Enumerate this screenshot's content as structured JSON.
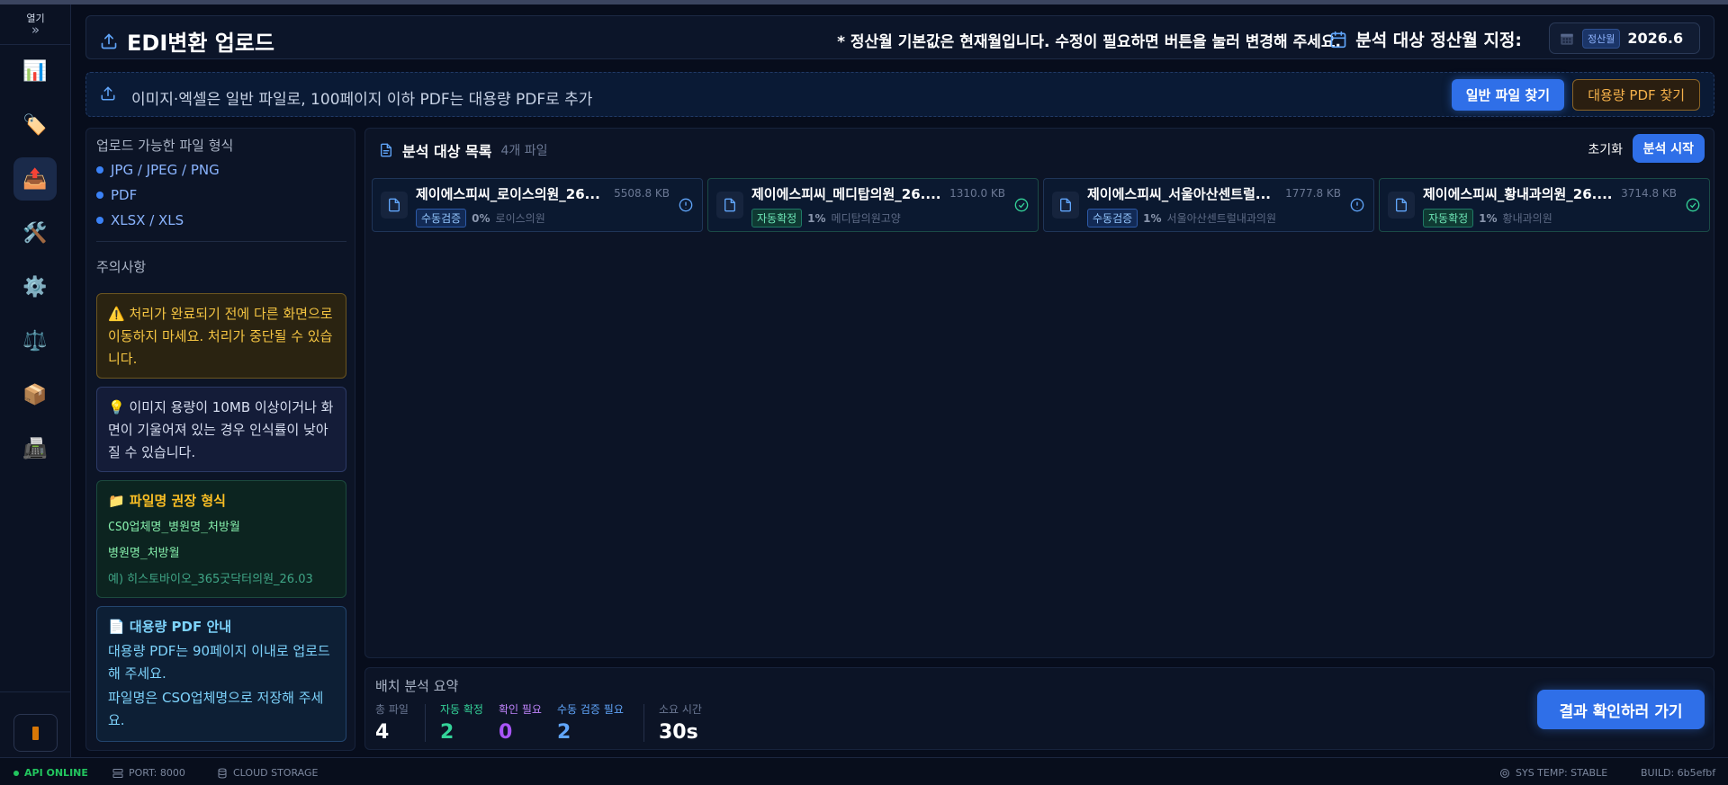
{
  "sidebar": {
    "open_label": "열기",
    "expand_glyph": "»",
    "items": [
      {
        "icon": "bar-chart-icon",
        "glyph": "📊"
      },
      {
        "icon": "price-tag-icon",
        "glyph": "🏷️"
      },
      {
        "icon": "upload-tray-icon",
        "glyph": "📤",
        "active": true
      },
      {
        "icon": "tools-icon",
        "glyph": "🛠️"
      },
      {
        "icon": "gear-icon",
        "glyph": "⚙️"
      },
      {
        "icon": "scales-icon",
        "glyph": "⚖️"
      },
      {
        "icon": "package-icon",
        "glyph": "📦"
      },
      {
        "icon": "printer-icon",
        "glyph": "📠"
      }
    ]
  },
  "header": {
    "title": "EDI변환 업로드",
    "note": "* 정산월 기본값은 현재월입니다. 수정이 필요하면 버튼을 눌러 변경해 주세요.",
    "period_label": "분석 대상 정산월 지정:",
    "period_tag": "정산월",
    "period_value": "2026.6"
  },
  "upload_bar": {
    "text": "이미지·엑셀은 일반 파일로, 100페이지 이하 PDF는 대용량 PDF로 추가",
    "normal_button": "일반 파일 찾기",
    "pdf_button": "대용량 PDF 찾기"
  },
  "left_panel": {
    "formats_title": "업로드 가능한 파일 형식",
    "formats": [
      "JPG / JPEG / PNG",
      "PDF",
      "XLSX / XLS"
    ],
    "notes_title": "주의사항",
    "warning": "처리가 완료되기 전에 다른 화면으로 이동하지 마세요. 처리가 중단될 수 있습니다.",
    "tip": "이미지 용량이 10MB 이상이거나 화면이 기울어져 있는 경우 인식률이 낮아질 수 있습니다.",
    "filename_title": "파일명 권장 형식",
    "filename_format1": "CSO업체명_병원명_처방월",
    "filename_format2": "병원명_처방월",
    "filename_example": "예) 히스토바이오_365굿닥터의원_26.03",
    "pdf_title": "대용량 PDF 안내",
    "pdf_line1": "대용량 PDF는 90페이지 이내로 업로드해 주세요.",
    "pdf_line2": "파일명은 CSO업체명으로 저장해 주세요."
  },
  "file_list": {
    "title": "분석 대상 목록",
    "count": "4개 파일",
    "reset": "초기화",
    "start": "분석 시작",
    "files": [
      {
        "name": "제이에스피씨_로이스의원_26...",
        "size": "5508.8 KB",
        "tag": "수동검증",
        "tag_type": "manual",
        "pct": "0%",
        "hospital": "로이스의원",
        "status": "alert"
      },
      {
        "name": "제이에스피씨_메디탑의원_26....",
        "size": "1310.0 KB",
        "tag": "자동확정",
        "tag_type": "auto",
        "pct": "1%",
        "hospital": "메디탑의원고양",
        "status": "check"
      },
      {
        "name": "제이에스피씨_서울아산센트럴...",
        "size": "1777.8 KB",
        "tag": "수동검증",
        "tag_type": "manual",
        "pct": "1%",
        "hospital": "서울아산센트럴내과의원",
        "status": "alert"
      },
      {
        "name": "제이에스피씨_황내과의원_26....",
        "size": "3714.8 KB",
        "tag": "자동확정",
        "tag_type": "auto",
        "pct": "1%",
        "hospital": "황내과의원",
        "status": "check"
      }
    ]
  },
  "summary": {
    "title": "배치 분석 요약",
    "total_label": "총 파일",
    "total": "4",
    "auto_label": "자동 확정",
    "auto": "2",
    "check_label": "확인 필요",
    "check": "0",
    "manual_label": "수동 검증 필요",
    "manual": "2",
    "time_label": "소요 시간",
    "time": "30s",
    "go_button": "결과 확인하러 가기"
  },
  "footer": {
    "api": "API ONLINE",
    "port": "PORT: 8000",
    "storage": "CLOUD STORAGE",
    "temp": "SYS TEMP: STABLE",
    "build": "BUILD: 6b5efbf"
  },
  "colors": {
    "accent": "#2f6fe8",
    "warning": "#f5c542",
    "success": "#22c55e",
    "check_purple": "#a855f7",
    "manual_blue": "#60a5fa",
    "auto_green": "#34d399"
  }
}
